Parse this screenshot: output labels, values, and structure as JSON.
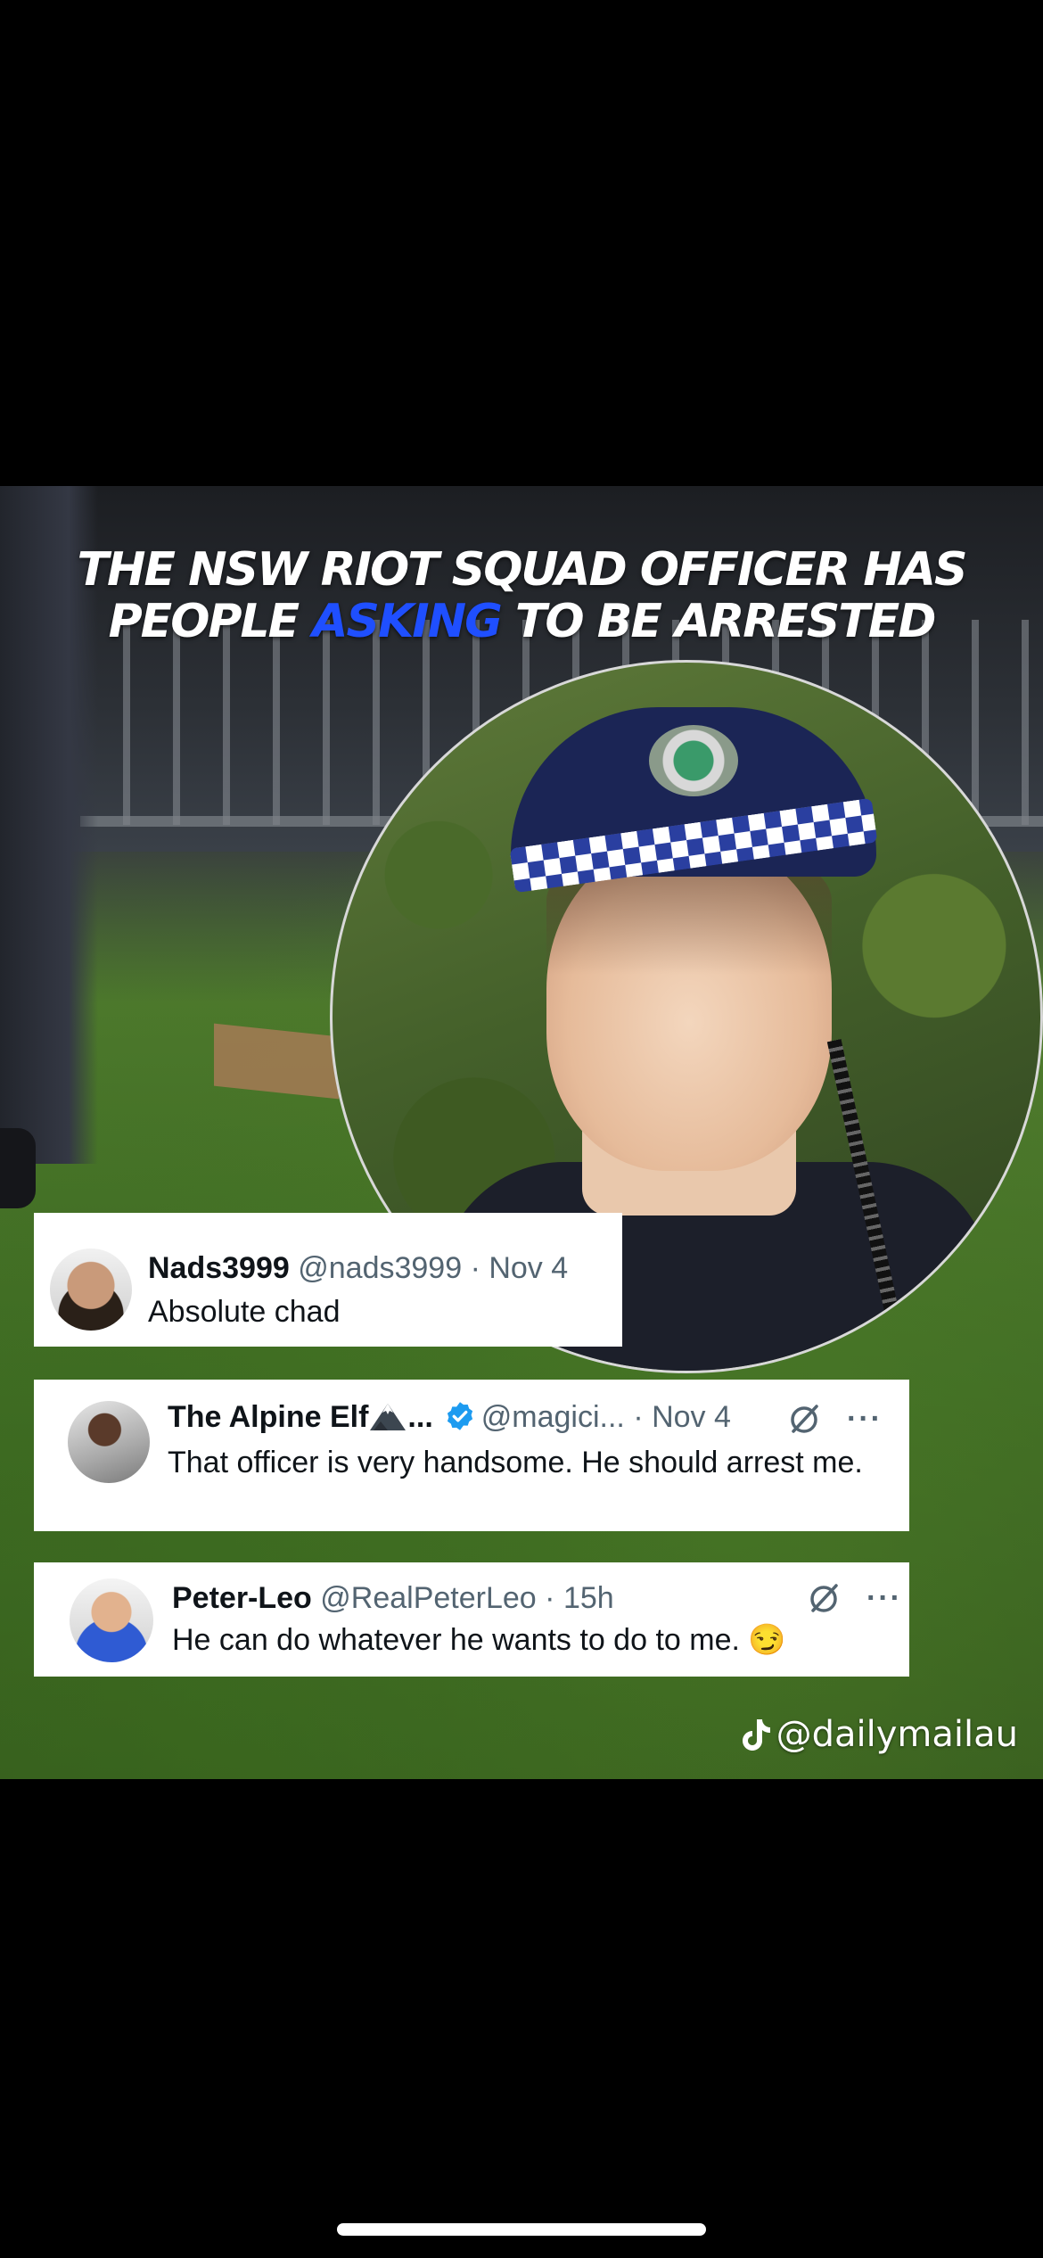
{
  "headline": {
    "line1": "THE NSW RIOT SQUAD OFFICER HAS",
    "line2_before": "PEOPLE ",
    "line2_accent": "ASKING",
    "line2_after": " TO BE ARRESTED",
    "accent_color": "#1f4fff"
  },
  "tweets": [
    {
      "name": "Nads3999",
      "handle": "@nads3999",
      "date": "· Nov 4",
      "text": "Absolute chad"
    },
    {
      "name": "The Alpine Elf",
      "name_icon": "mountain-icon",
      "name_truncation": "...",
      "verified": true,
      "handle": "@magici...",
      "date": "· Nov 4",
      "text": "That officer is very handsome. He should arrest me."
    },
    {
      "name": "Peter-Leo",
      "handle": "@RealPeterLeo",
      "date": "· 15h",
      "text": "He can do whatever he wants to do to me. 😏"
    }
  ],
  "watermark": {
    "icon": "tiktok-icon",
    "handle": "@dailymailau"
  },
  "colors": {
    "verified_blue": "#1d9bf0",
    "meta_gray": "#536471"
  }
}
